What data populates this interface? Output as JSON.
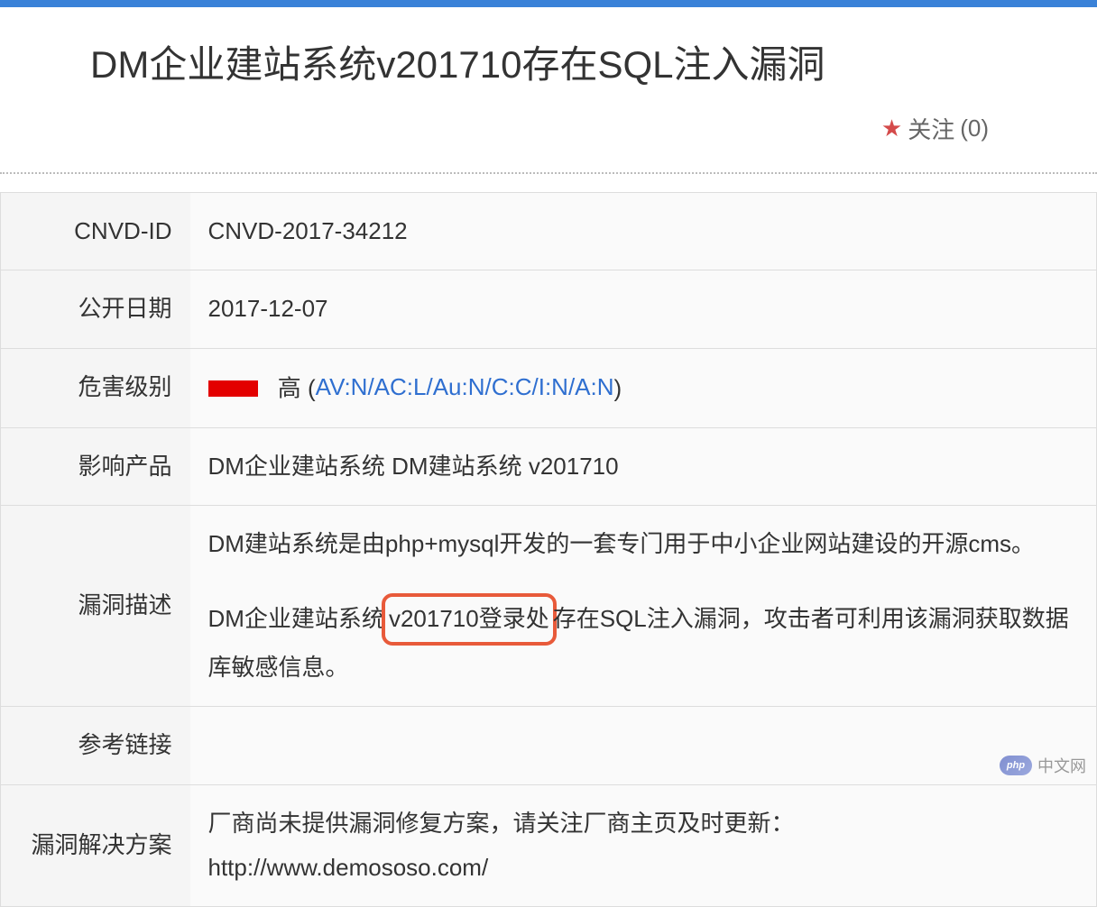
{
  "header": {
    "title": "DM企业建站系统v201710存在SQL注入漏洞",
    "follow_label": "关注",
    "follow_count": "(0)"
  },
  "rows": {
    "cnvd_id": {
      "label": "CNVD-ID",
      "value": "CNVD-2017-34212"
    },
    "open_date": {
      "label": "公开日期",
      "value": "2017-12-07"
    },
    "severity": {
      "label": "危害级别",
      "level": "高",
      "vector_prefix": "(",
      "vector": "AV:N/AC:L/Au:N/C:C/I:N/A:N",
      "vector_suffix": ")"
    },
    "product": {
      "label": "影响产品",
      "value": "DM企业建站系统 DM建站系统 v201710"
    },
    "description": {
      "label": "漏洞描述",
      "para1": "DM建站系统是由php+mysql开发的一套专门用于中小企业网站建设的开源cms。",
      "para2_pre": "DM企业建站系统",
      "para2_highlight": "v201710登录处",
      "para2_mid": "存",
      "para2_post": "在SQL注入漏洞，攻击者可利用该漏洞获取数据库敏感信息。"
    },
    "reference": {
      "label": "参考链接",
      "value": ""
    },
    "solution": {
      "label": "漏洞解决方案",
      "line1": "厂商尚未提供漏洞修复方案，请关注厂商主页及时更新：",
      "line2": "http://www.demososo.com/"
    }
  },
  "watermark": {
    "logo_text": "php",
    "text": "中文网"
  }
}
